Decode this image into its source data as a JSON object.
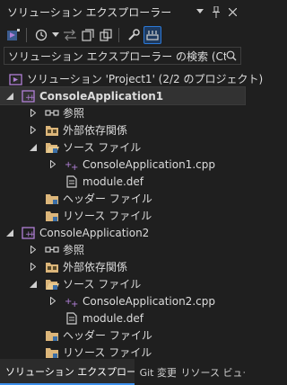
{
  "window": {
    "title": "ソリューション エクスプローラー",
    "actions": [
      "▾",
      "⊣",
      "✕"
    ]
  },
  "toolbar": {
    "icons": [
      "vs-switch-view-icon",
      "history-icon",
      "chevron-down-icon",
      "sync-arrows-icon",
      "copy-windows-icon",
      "wrench-icon",
      "pin-toggle-icon"
    ]
  },
  "search": {
    "text": "ソリューション エクスプローラー の検索 (Ctrl+:)"
  },
  "tree": {
    "solution": "ソリューション 'Project1' (2/2 のプロジェクト)",
    "projects": [
      {
        "name": "ConsoleApplication1",
        "references": "参照",
        "external": "外部依存関係",
        "source_folder": "ソース ファイル",
        "cpp": "ConsoleApplication1.cpp",
        "def": "module.def",
        "header_folder": "ヘッダー ファイル",
        "resource_folder": "リソース ファイル"
      },
      {
        "name": "ConsoleApplication2",
        "references": "参照",
        "external": "外部依存関係",
        "source_folder": "ソース ファイル",
        "cpp": "ConsoleApplication2.cpp",
        "def": "module.def",
        "header_folder": "ヘッダー ファイル",
        "resource_folder": "リソース ファイル"
      }
    ]
  },
  "tabs": [
    "ソリューション エクスプローラー",
    "Git 変更",
    "リソース ビュー"
  ],
  "colors": {
    "background": "#1f1f1f",
    "selection": "#323232",
    "accent": "#3b8eea",
    "folder": "#dcb67a",
    "project": "#b180d7"
  }
}
